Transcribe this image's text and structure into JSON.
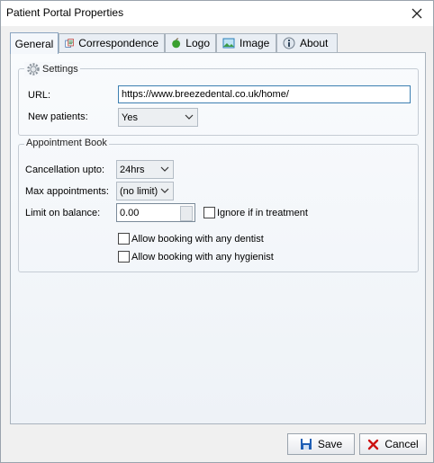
{
  "window": {
    "title": "Patient Portal Properties"
  },
  "tabs": [
    {
      "label": "General",
      "icon": "none"
    },
    {
      "label": "Correspondence",
      "icon": "documents-icon"
    },
    {
      "label": "Logo",
      "icon": "apple-icon"
    },
    {
      "label": "Image",
      "icon": "image-icon"
    },
    {
      "label": "About",
      "icon": "info-icon"
    }
  ],
  "settings": {
    "legend": "Settings",
    "url_label": "URL:",
    "url_value": "https://www.breezedental.co.uk/home/",
    "new_patients_label": "New patients:",
    "new_patients_value": "Yes"
  },
  "appointment_book": {
    "legend": "Appointment Book",
    "cancellation_label": "Cancellation upto:",
    "cancellation_value": "24hrs",
    "max_label": "Max appointments:",
    "max_value": "(no limit)",
    "limit_label": "Limit on balance:",
    "limit_value": "0.00",
    "ignore_label": "Ignore if in treatment",
    "any_dentist_label": "Allow booking with any dentist",
    "any_hygienist_label": "Allow booking with any hygienist"
  },
  "buttons": {
    "save": "Save",
    "cancel": "Cancel"
  },
  "colors": {
    "accent": "#0066cc",
    "cancel_x": "#cc1111",
    "focus_border": "#3c7fb1"
  }
}
